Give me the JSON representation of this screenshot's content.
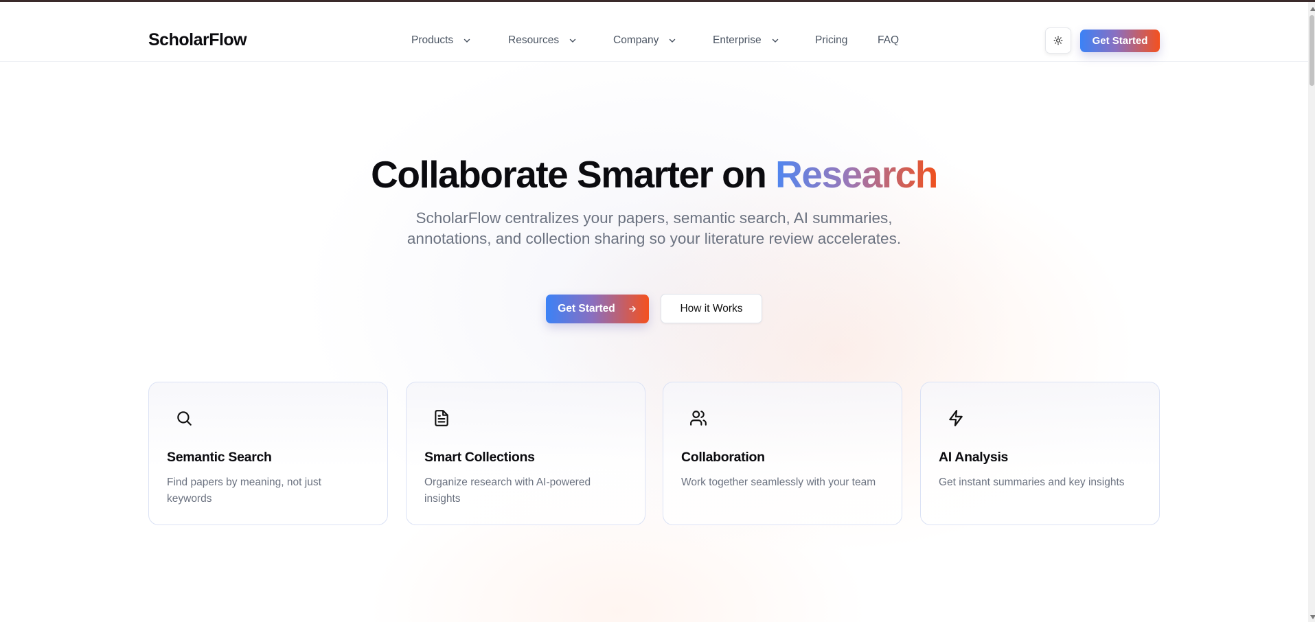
{
  "header": {
    "logo": "ScholarFlow",
    "nav": [
      {
        "label": "Products",
        "has_dropdown": true
      },
      {
        "label": "Resources",
        "has_dropdown": true
      },
      {
        "label": "Company",
        "has_dropdown": true
      },
      {
        "label": "Enterprise",
        "has_dropdown": true
      },
      {
        "label": "Pricing",
        "has_dropdown": false
      },
      {
        "label": "FAQ",
        "has_dropdown": false
      }
    ],
    "theme_toggle_icon": "sun-icon",
    "cta_label": "Get Started"
  },
  "hero": {
    "title_main": "Collaborate Smarter on ",
    "title_accent": "Research",
    "subtitle": "ScholarFlow centralizes your papers, semantic search, AI summaries, annotations, and collection sharing so your literature review accelerates.",
    "primary_cta": "Get Started",
    "primary_cta_icon": "arrow-right-icon",
    "secondary_cta": "How it Works"
  },
  "features": [
    {
      "icon": "search-icon",
      "title": "Semantic Search",
      "description": "Find papers by meaning, not just keywords"
    },
    {
      "icon": "document-icon",
      "title": "Smart Collections",
      "description": "Organize research with AI-powered insights"
    },
    {
      "icon": "users-icon",
      "title": "Collaboration",
      "description": "Work together seamlessly with your team"
    },
    {
      "icon": "lightning-icon",
      "title": "AI Analysis",
      "description": "Get instant summaries and key insights"
    }
  ],
  "colors": {
    "gradient_start": "#3b82f6",
    "gradient_mid": "#8a6fc0",
    "gradient_end": "#f4511e",
    "text_primary": "#0b0b0f",
    "text_muted": "#6b7280"
  }
}
